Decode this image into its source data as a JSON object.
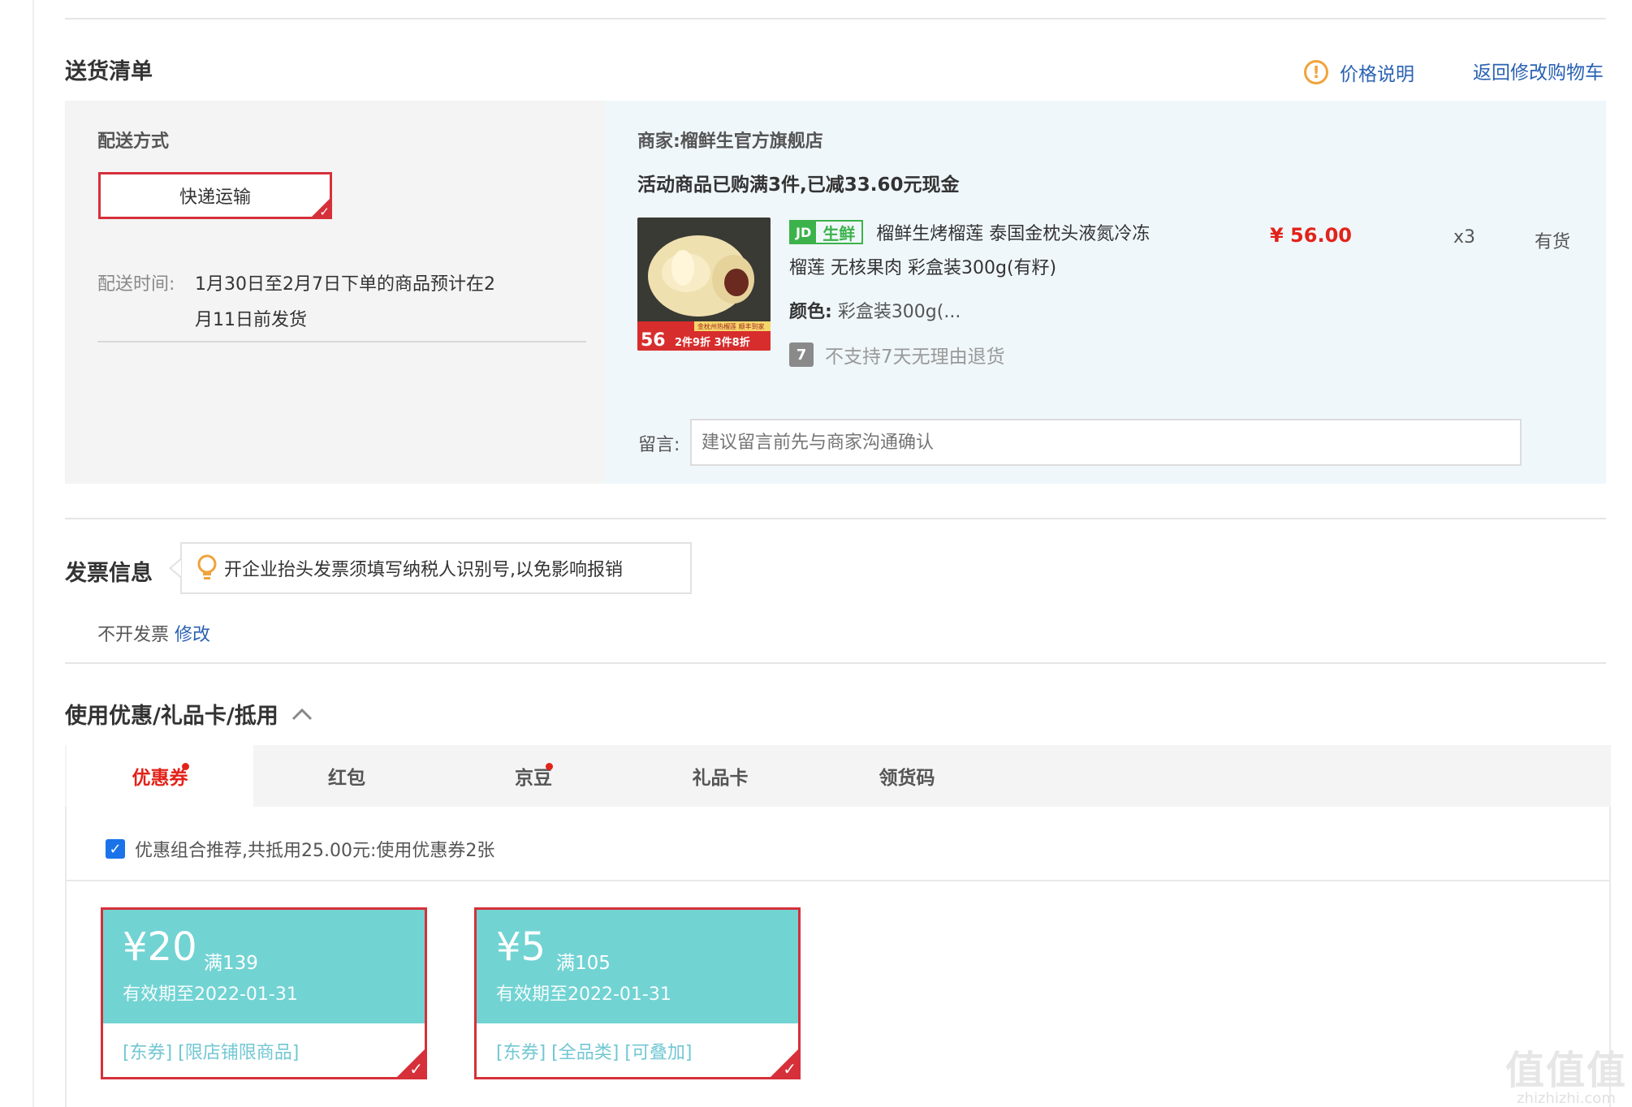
{
  "delivery": {
    "title": "送货清单",
    "price_note": "价格说明",
    "back_to_cart": "返回修改购物车",
    "method_label": "配送方式",
    "method_value": "快递运输",
    "time_label": "配送时间:",
    "time_line1": "1月30日至2月7日下单的商品预计在2",
    "time_line2": "月11日前发货"
  },
  "shop": {
    "merchant": "商家:榴鲜生官方旗舰店",
    "promo": "活动商品已购满3件,已减33.60元现金",
    "product": {
      "badge": "生鲜",
      "title_line1": "榴鲜生烤榴莲 泰国金枕头液氮冷冻",
      "title_line2": "榴莲 无核果肉 彩盒装300g(有籽)",
      "color_label": "颜色:",
      "color_value": "彩盒装300g(...",
      "return_icon_text": "7",
      "return_policy": "不支持7天无理由退货",
      "price": "¥ 56.00",
      "quantity": "x3",
      "stock": "有货",
      "img_price": "56",
      "img_promo": "2件9折 3件8折",
      "img_top": "金枕州热榴莲 顺丰到家"
    },
    "message_label": "留言:",
    "message_placeholder": "建议留言前先与商家沟通确认"
  },
  "invoice": {
    "title": "发票信息",
    "tip": "开企业抬头发票须填写纳税人识别号,以免影响报销",
    "status": "不开发票",
    "edit": "修改"
  },
  "discounts": {
    "title": "使用优惠/礼品卡/抵用",
    "tabs": [
      {
        "label": "优惠券",
        "dot": true,
        "active": true
      },
      {
        "label": "红包",
        "dot": false,
        "active": false
      },
      {
        "label": "京豆",
        "dot": true,
        "active": false
      },
      {
        "label": "礼品卡",
        "dot": false,
        "active": false
      },
      {
        "label": "领货码",
        "dot": false,
        "active": false
      }
    ],
    "recommend": "优惠组合推荐,共抵用25.00元:使用优惠券2张",
    "coupons": [
      {
        "amount": "¥20",
        "condition": "满139",
        "valid": "有效期至2022-01-31",
        "tags": "[东券] [限店铺限商品]"
      },
      {
        "amount": "¥5",
        "condition": "满105",
        "valid": "有效期至2022-01-31",
        "tags": "[东券] [全品类] [可叠加]"
      }
    ]
  },
  "watermark": {
    "big": "值值值",
    "small": "zhizhizhi.com"
  },
  "colors": {
    "accent_red": "#e2231a",
    "link_blue": "#2a62b3",
    "coupon_teal": "#72d3d3",
    "fresh_green": "#3cb34a"
  }
}
